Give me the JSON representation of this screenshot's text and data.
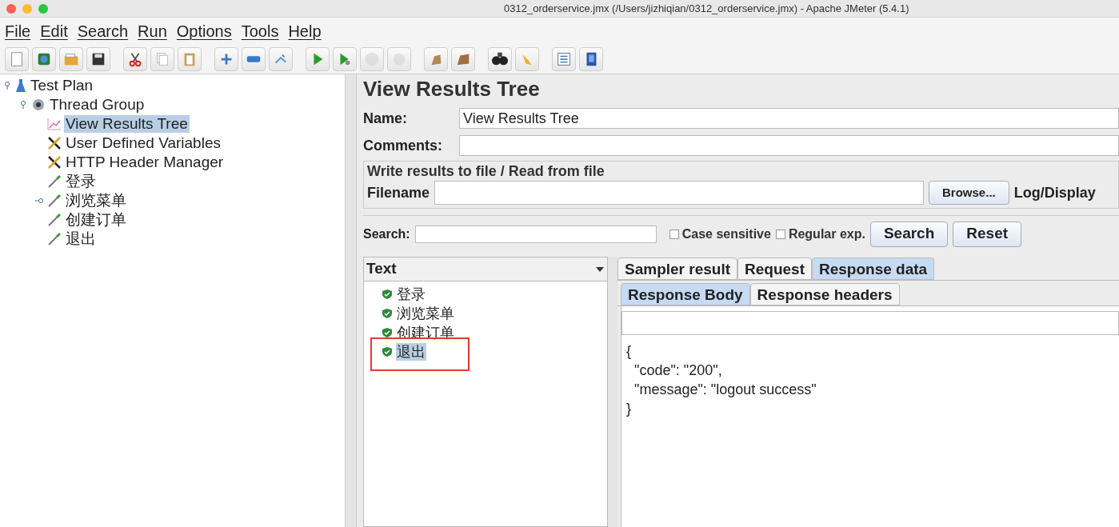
{
  "window": {
    "title": "0312_orderservice.jmx (/Users/jizhiqian/0312_orderservice.jmx) - Apache JMeter (5.4.1)"
  },
  "menu": [
    "File",
    "Edit",
    "Search",
    "Run",
    "Options",
    "Tools",
    "Help"
  ],
  "toolbar": [
    {
      "disabled": false
    },
    {
      "disabled": false
    },
    {
      "disabled": false
    },
    {
      "disabled": false
    },
    {
      "disabled": false
    },
    {
      "disabled": false
    },
    {
      "disabled": false
    },
    {
      "disabled": false
    },
    {
      "disabled": false
    },
    {
      "disabled": false
    },
    {
      "disabled": false
    },
    {
      "disabled": false
    },
    {
      "disabled": true
    },
    {
      "disabled": true
    },
    {
      "disabled": false
    },
    {
      "disabled": false
    },
    {
      "disabled": false
    },
    {
      "disabled": false
    },
    {
      "disabled": false
    },
    {
      "disabled": false
    }
  ],
  "tree": [
    {
      "label": "Test Plan",
      "kind": "plan",
      "selected": false,
      "expanded": true,
      "children": [
        {
          "label": "Thread Group",
          "kind": "group",
          "selected": false,
          "expanded": true,
          "children": [
            {
              "label": "View Results Tree",
              "kind": "listener",
              "selected": true
            },
            {
              "label": "User Defined Variables",
              "kind": "config",
              "selected": false
            },
            {
              "label": "HTTP Header Manager",
              "kind": "config",
              "selected": false
            },
            {
              "label": "登录",
              "kind": "sampler",
              "selected": false
            },
            {
              "label": "浏览菜单",
              "kind": "sampler",
              "selected": false,
              "expanded": false
            },
            {
              "label": "创建订单",
              "kind": "sampler",
              "selected": false
            },
            {
              "label": "退出",
              "kind": "sampler",
              "selected": false
            }
          ]
        }
      ]
    }
  ],
  "panel": {
    "title": "View Results Tree",
    "name_label": "Name:",
    "name_value": "View Results Tree",
    "comments_label": "Comments:",
    "file_group": {
      "title": "Write results to file / Read from file",
      "filename_label": "Filename",
      "browse": "Browse...",
      "log_display": "Log/Display"
    },
    "search": {
      "label": "Search:",
      "case_sensitive": {
        "label": "Case sensitive",
        "checked": false
      },
      "regular_exp": {
        "label": "Regular exp.",
        "checked": false
      },
      "search_button": "Search",
      "reset_button": "Reset"
    },
    "renderer": "Text",
    "results": [
      {
        "label": "登录",
        "success": true,
        "selected": false,
        "highlighted": false
      },
      {
        "label": "浏览菜单",
        "success": true,
        "selected": false,
        "highlighted": false
      },
      {
        "label": "创建订单",
        "success": true,
        "selected": false,
        "highlighted": false
      },
      {
        "label": "退出",
        "success": true,
        "selected": true,
        "highlighted": true
      }
    ],
    "tabs": [
      {
        "label": "Sampler result",
        "selected": false
      },
      {
        "label": "Request",
        "selected": false
      },
      {
        "label": "Response data",
        "selected": true
      }
    ],
    "subtabs": [
      {
        "label": "Response Body",
        "selected": true
      },
      {
        "label": "Response headers",
        "selected": false
      }
    ],
    "body_lines": [
      "{",
      "  \"code\": \"200\",",
      "  \"message\": \"logout success\"",
      "}"
    ]
  }
}
